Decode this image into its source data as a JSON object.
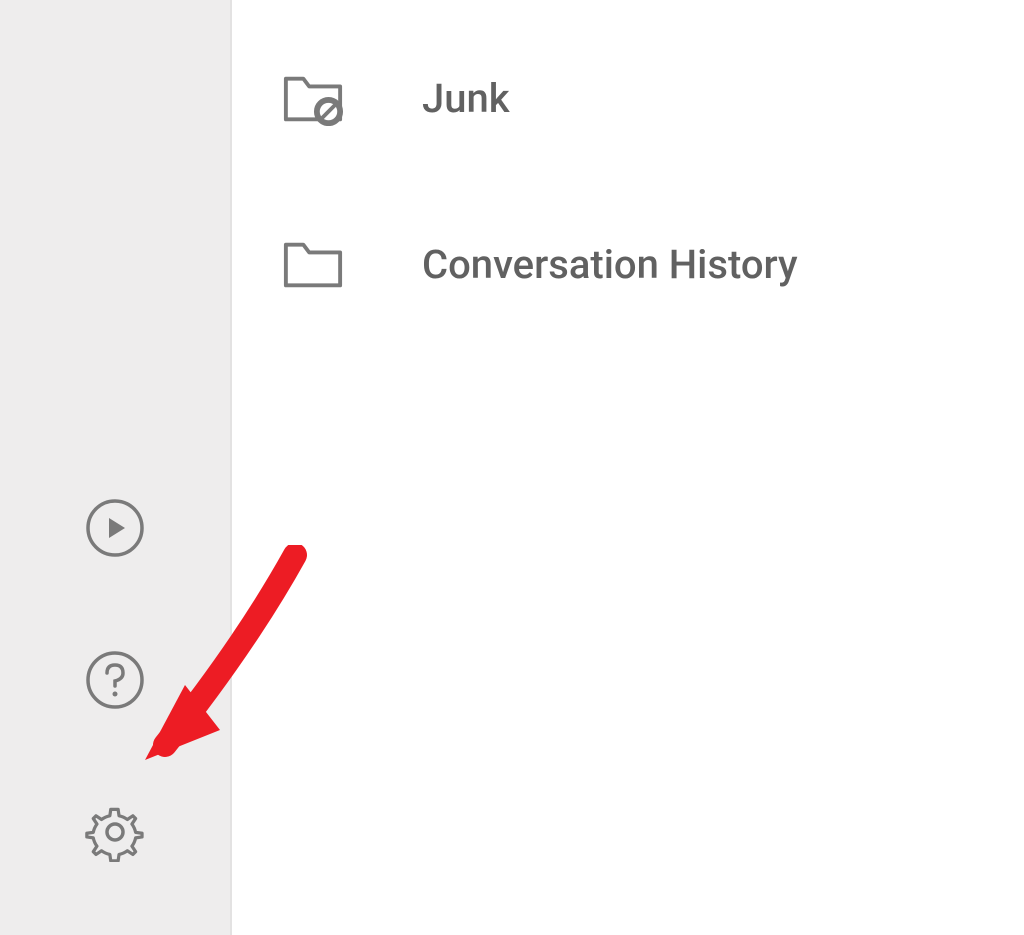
{
  "sidebar": {
    "rail_icons": [
      {
        "name": "play-icon"
      },
      {
        "name": "help-icon"
      },
      {
        "name": "gear-icon"
      }
    ]
  },
  "folders": {
    "items": [
      {
        "label": "Junk",
        "icon": "junk-folder-icon"
      },
      {
        "label": "Conversation History",
        "icon": "folder-icon"
      }
    ]
  },
  "annotation": {
    "type": "arrow",
    "color": "#ED1C24"
  }
}
